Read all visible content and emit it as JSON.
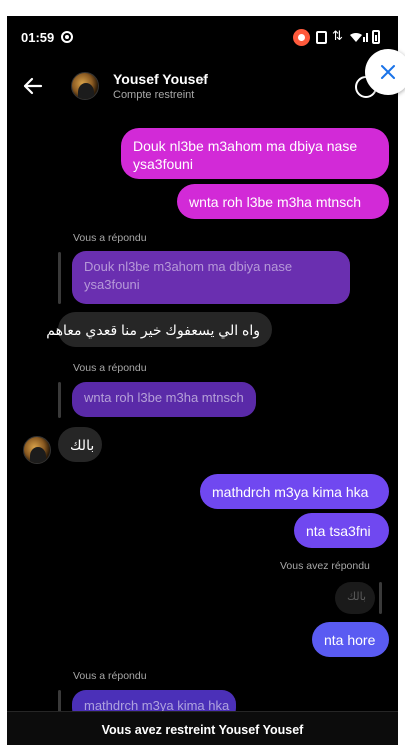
{
  "status": {
    "time": "01:59"
  },
  "header": {
    "contact_name": "Yousef Yousef",
    "subtitle": "Compte restreint"
  },
  "messages": {
    "out1": "Douk nl3be m3ahom ma dbiya nase ysa3founi",
    "out1_line1": "Douk nl3be m3ahom ma dbiya nase",
    "out1_line2": "ysa3founi",
    "out2": "wnta roh l3be m3ha mtnsch",
    "replied1_meta": "Vous a répondu",
    "replied1_quote_line1": "Douk nl3be m3ahom ma dbiya nase",
    "replied1_quote_line2": "ysa3founi",
    "in1": "واه الي يسعفوك خير منا قعدي معاهم",
    "replied2_meta": "Vous a répondu",
    "replied2_quote": "wnta roh l3be m3ha mtnsch",
    "in2": "بالك",
    "out3": "mathdrch m3ya kima hka",
    "out4": "nta tsa3fni",
    "replied3_meta": "Vous avez répondu",
    "replied3_quote": "بالك",
    "out5": "nta hore",
    "replied4_meta": "Vous a répondu",
    "replied4_quote": "mathdrch m3ya kima hka"
  },
  "footer": {
    "restricted_text": "Vous avez restreint Yousef Yousef"
  },
  "colors": {
    "background": "#000000",
    "outgoing_pink": "#d22ad7",
    "outgoing_purple": "#7c48ef",
    "outgoing_blue": "#5a5bf2",
    "incoming": "#262626"
  },
  "icons": [
    "record-icon",
    "back-arrow-icon",
    "info-icon",
    "close-icon",
    "signal-icon",
    "wifi-icon",
    "battery-icon"
  ]
}
